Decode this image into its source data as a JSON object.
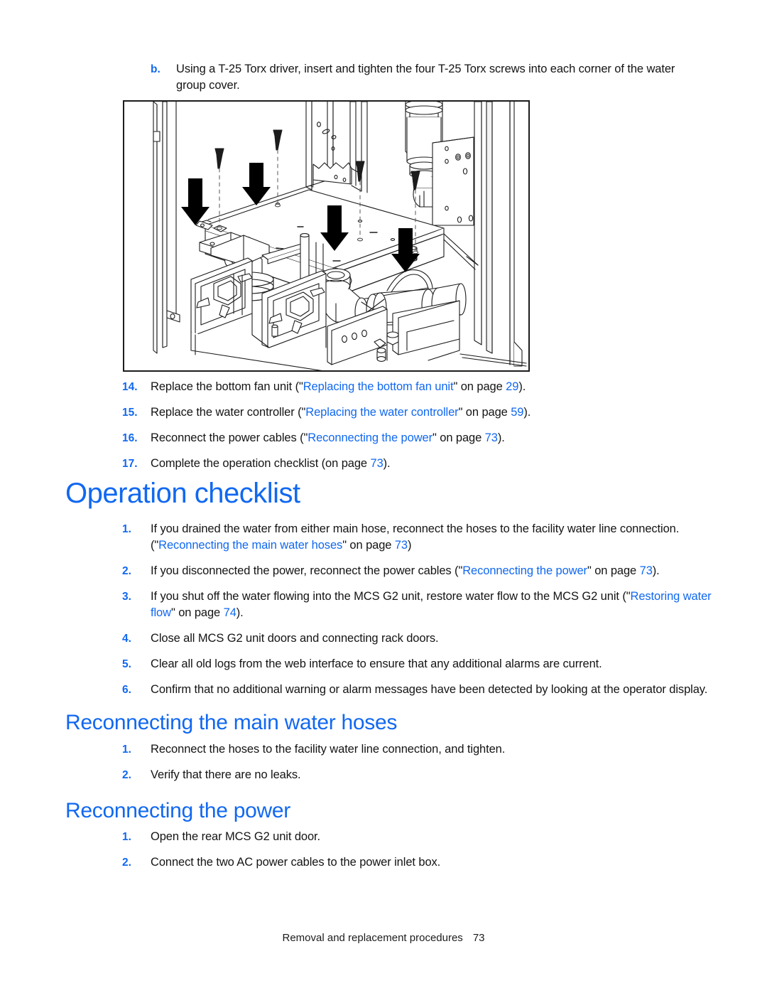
{
  "sublist": {
    "items": [
      {
        "marker": "b.",
        "text": "Using a T-25 Torx driver, insert and tighten the four T-25 Torx screws into each corner of the water group cover."
      }
    ]
  },
  "figure": {
    "caption": "",
    "alt_name": "water-group-cover-installation-diagram",
    "callouts": {
      "arrow_count": 4,
      "screw_count": 4
    }
  },
  "steps": {
    "items": [
      {
        "marker": "14.",
        "pre": "Replace the bottom fan unit (\"",
        "link": "Replacing the bottom fan unit",
        "mid": "\" on page ",
        "page": "29",
        "post": ")."
      },
      {
        "marker": "15.",
        "pre": "Replace the water controller (\"",
        "link": "Replacing the water controller",
        "mid": "\" on page ",
        "page": "59",
        "post": ")."
      },
      {
        "marker": "16.",
        "pre": "Reconnect the power cables (\"",
        "link": "Reconnecting the power",
        "mid": "\" on page ",
        "page": "73",
        "post": ")."
      },
      {
        "marker": "17.",
        "pre": "Complete the operation checklist (on page ",
        "link": "",
        "mid": "",
        "page": "73",
        "post": ")."
      }
    ]
  },
  "headings": {
    "operation_checklist": "Operation checklist",
    "reconnecting_main_water_hoses": "Reconnecting the main water hoses",
    "reconnecting_the_power": "Reconnecting the power"
  },
  "checklist": {
    "items": [
      {
        "marker": "1.",
        "pre": "If you drained the water from either main hose, reconnect the hoses to the facility water line connection. (\"",
        "link": "Reconnecting the main water hoses",
        "mid": "\" on page ",
        "page": "73",
        "post": ")"
      },
      {
        "marker": "2.",
        "pre": "If you disconnected the power, reconnect the power cables (\"",
        "link": "Reconnecting the power",
        "mid": "\" on page ",
        "page": "73",
        "post": ")."
      },
      {
        "marker": "3.",
        "pre": "If you shut off the water flowing into the MCS G2 unit, restore water flow to the  MCS G2 unit (\"",
        "link": "Restoring water flow",
        "mid": "\" on page ",
        "page": "74",
        "post": ")."
      },
      {
        "marker": "4.",
        "pre": "Close all MCS G2 unit doors and connecting rack doors.",
        "link": "",
        "mid": "",
        "page": "",
        "post": ""
      },
      {
        "marker": "5.",
        "pre": "Clear all old logs from the web interface to ensure that any additional alarms are current.",
        "link": "",
        "mid": "",
        "page": "",
        "post": ""
      },
      {
        "marker": "6.",
        "pre": "Confirm that no additional warning or alarm messages have been detected by looking at the operator display.",
        "link": "",
        "mid": "",
        "page": "",
        "post": ""
      }
    ]
  },
  "hoses": {
    "items": [
      {
        "marker": "1.",
        "pre": "Reconnect the hoses to the facility water line connection, and tighten.",
        "link": "",
        "mid": "",
        "page": "",
        "post": ""
      },
      {
        "marker": "2.",
        "pre": "Verify that there are no leaks.",
        "link": "",
        "mid": "",
        "page": "",
        "post": ""
      }
    ]
  },
  "power": {
    "items": [
      {
        "marker": "1.",
        "pre": "Open the rear MCS G2 unit door.",
        "link": "",
        "mid": "",
        "page": "",
        "post": ""
      },
      {
        "marker": "2.",
        "pre": "Connect the two AC power cables to the power inlet box.",
        "link": "",
        "mid": "",
        "page": "",
        "post": ""
      }
    ]
  },
  "footer": {
    "text": "Removal and replacement procedures",
    "page_number": "73"
  },
  "colors": {
    "link_blue": "#1168f0",
    "heading_blue": "#1168f0",
    "body_black": "#141414"
  }
}
